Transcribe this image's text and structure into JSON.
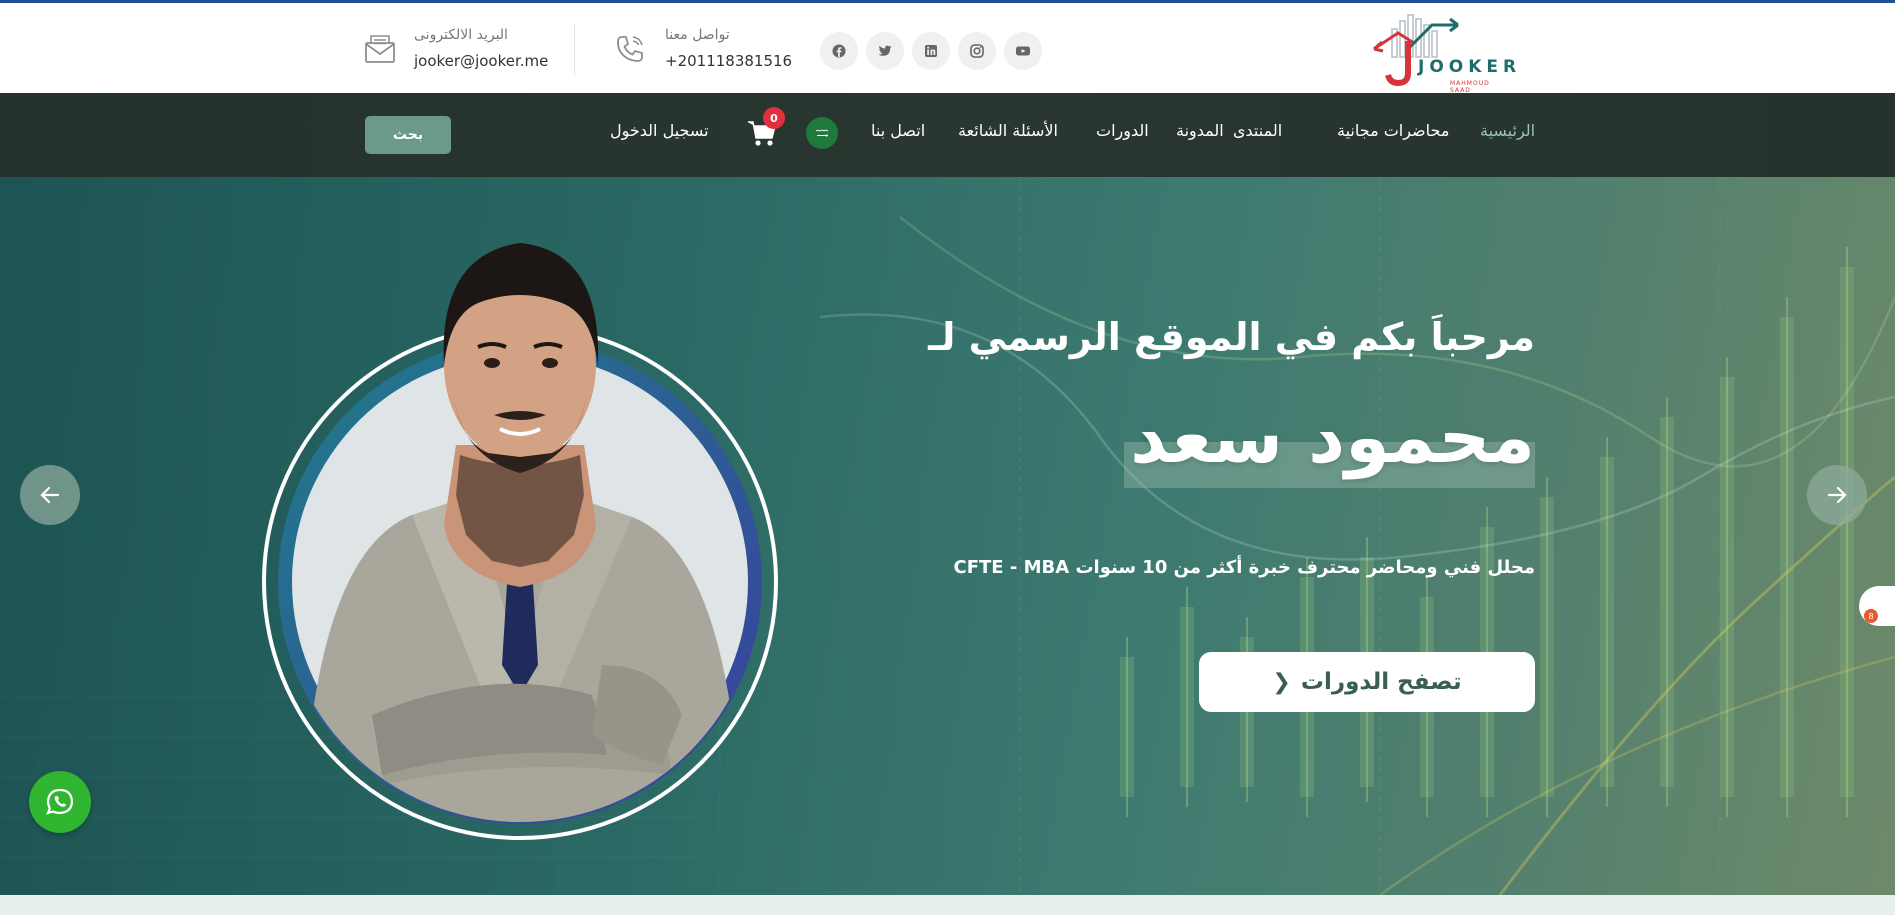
{
  "brand": {
    "name": "JOOKER",
    "sub": "MAHMOUD SAAD"
  },
  "header": {
    "phone": {
      "label": "تواصل معنا",
      "value": "+201118381516",
      "icon": "phone-icon"
    },
    "email": {
      "label": "البريد الالكترونى",
      "value": "jooker@jooker.me",
      "icon": "envelope-icon"
    },
    "socials": [
      "youtube-icon",
      "instagram-icon",
      "linkedin-icon",
      "twitter-icon",
      "facebook-icon"
    ]
  },
  "nav": {
    "items": [
      {
        "label": "الرئيسية",
        "active": true
      },
      {
        "label": "محاضرات مجانية"
      },
      {
        "label": "المنتدى"
      },
      {
        "label": "المدونة"
      },
      {
        "label": "الدورات"
      },
      {
        "label": "الأسئلة الشائعة"
      },
      {
        "label": "اتصل بنا"
      }
    ],
    "cart_count": "0",
    "login_label": "تسجيل الدخول",
    "search_label": "بحث"
  },
  "hero": {
    "greeting": "مرحباَ بكم في الموقع الرسمي لـ",
    "name": "محمود سعد",
    "description": "محلل فني ومحاضر محترف خبرة أكثر من 10 سنوات CFTE - MBA",
    "cta_label": "تصفح الدورات"
  },
  "widgets": {
    "side_badge": "8"
  },
  "colors": {
    "accent": "#6b9a88",
    "nav_bg": "#26322d",
    "active_nav": "#9ac4b6",
    "cart_badge": "#e0303c",
    "whatsapp": "#2fb52f"
  }
}
